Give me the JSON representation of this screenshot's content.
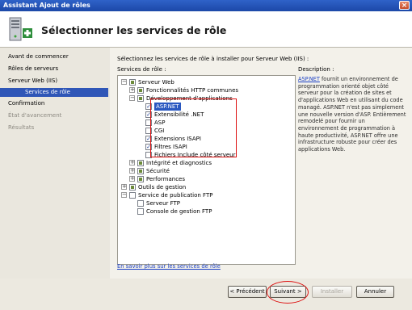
{
  "window": {
    "title": "Assistant Ajout de rôles",
    "close_symbol": "×"
  },
  "header": {
    "title": "Sélectionner les services de rôle",
    "icon": "server-roles-icon"
  },
  "nav": {
    "items": [
      {
        "label": "Avant de commencer",
        "state": "normal"
      },
      {
        "label": "Rôles de serveurs",
        "state": "normal"
      },
      {
        "label": "Serveur Web (IIS)",
        "state": "normal"
      },
      {
        "label": "Services de rôle",
        "state": "selected"
      },
      {
        "label": "Confirmation",
        "state": "normal"
      },
      {
        "label": "État d'avancement",
        "state": "disabled"
      },
      {
        "label": "Résultats",
        "state": "disabled"
      }
    ]
  },
  "content": {
    "lead": "Sélectionnez les services de rôle à installer pour Serveur Web (IIS) :",
    "services_label": "Services de rôle :",
    "tree": [
      {
        "label": "Serveur Web",
        "level": 0,
        "expander": "−",
        "check": "partial"
      },
      {
        "label": "Fonctionnalités HTTP communes",
        "level": 1,
        "expander": "+",
        "check": "partial"
      },
      {
        "label": "Développement d'applications",
        "level": 1,
        "expander": "−",
        "check": "partial"
      },
      {
        "label": "ASP.NET",
        "level": 2,
        "check": "checked",
        "selected": true
      },
      {
        "label": "Extensibilité .NET",
        "level": 2,
        "check": "checked"
      },
      {
        "label": "ASP",
        "level": 2,
        "check": "unchecked"
      },
      {
        "label": "CGI",
        "level": 2,
        "check": "unchecked"
      },
      {
        "label": "Extensions ISAPI",
        "level": 2,
        "check": "checked"
      },
      {
        "label": "Filtres ISAPI",
        "level": 2,
        "check": "checked"
      },
      {
        "label": "Fichiers Include côté serveur",
        "level": 2,
        "check": "unchecked"
      },
      {
        "label": "Intégrité et diagnostics",
        "level": 1,
        "expander": "+",
        "check": "partial"
      },
      {
        "label": "Sécurité",
        "level": 1,
        "expander": "+",
        "check": "partial"
      },
      {
        "label": "Performances",
        "level": 1,
        "expander": "+",
        "check": "partial"
      },
      {
        "label": "Outils de gestion",
        "level": 0,
        "expander": "+",
        "check": "partial"
      },
      {
        "label": "Service de publication FTP",
        "level": 0,
        "expander": "−",
        "check": "unchecked"
      },
      {
        "label": "Serveur FTP",
        "level": 1,
        "check": "unchecked"
      },
      {
        "label": "Console de gestion FTP",
        "level": 1,
        "check": "unchecked"
      }
    ],
    "description_title": "Description :",
    "description_link": "ASP.NET",
    "description_text": " fournit un environnement de programmation orienté objet côté serveur pour la création de sites et d'applications Web en utilisant du code managé. ASP.NET n'est pas simplement une nouvelle version d'ASP. Entièrement remodelé pour fournir un environnement de programmation à haute productivité, ASP.NET offre une infrastructure robuste pour créer des applications Web.",
    "more_link": "En savoir plus sur les services de rôle"
  },
  "buttons": {
    "previous": "< Précédent",
    "next": "Suivant >",
    "install": "Installer",
    "cancel": "Annuler"
  },
  "colors": {
    "title_bar": "#1c48a8",
    "selection": "#2f56b7",
    "annotation_red": "#dd1111"
  }
}
